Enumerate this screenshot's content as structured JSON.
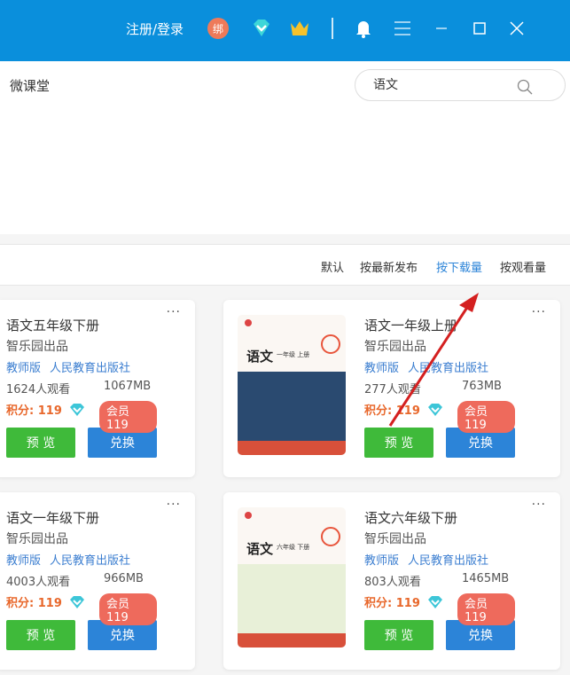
{
  "titlebar": {
    "login": "注册/登录",
    "bind_badge": "绑",
    "icons": [
      "diamond-icon",
      "crown-icon",
      "bell-icon",
      "menu-icon",
      "minimize-icon",
      "maximize-icon",
      "close-icon"
    ]
  },
  "nav": {
    "title": "微课堂",
    "search_value": "语文"
  },
  "sort": {
    "options": [
      "默认",
      "按最新发布",
      "按下载量",
      "按观看量"
    ],
    "active": "按下载量"
  },
  "cards": [
    {
      "title": "语文五年级下册",
      "publisher": "智乐园出品",
      "edition": "教师版",
      "press": "人民教育出版社",
      "views": "1624人观看",
      "size": "1067MB",
      "points": "积分: 119",
      "vip": "会员119",
      "preview": "预 览",
      "exchange": "兑换"
    },
    {
      "title": "语文一年级上册",
      "publisher": "智乐园出品",
      "edition": "教师版",
      "press": "人民教育出版社",
      "views": "277人观看",
      "size": "763MB",
      "points": "积分: 119",
      "vip": "会员119",
      "preview": "预 览",
      "exchange": "兑换",
      "cover_title": "语文",
      "cover_grade": "一年级  上册"
    },
    {
      "title": "语文一年级下册",
      "publisher": "智乐园出品",
      "edition": "教师版",
      "press": "人民教育出版社",
      "views": "4003人观看",
      "size": "966MB",
      "points": "积分: 119",
      "vip": "会员119",
      "preview": "预 览",
      "exchange": "兑换"
    },
    {
      "title": "语文六年级下册",
      "publisher": "智乐园出品",
      "edition": "教师版",
      "press": "人民教育出版社",
      "views": "803人观看",
      "size": "1465MB",
      "points": "积分: 119",
      "vip": "会员119",
      "preview": "预 览",
      "exchange": "兑换",
      "cover_title": "语文",
      "cover_grade": "六年级  下册"
    }
  ],
  "colors": {
    "titlebar": "#0a8fdc",
    "preview": "#3fba3a",
    "exchange": "#2c84d8",
    "vip": "#ee6a5c",
    "points": "#e8682c",
    "link": "#3b7ed0",
    "annotation_arrow": "#d42020"
  }
}
